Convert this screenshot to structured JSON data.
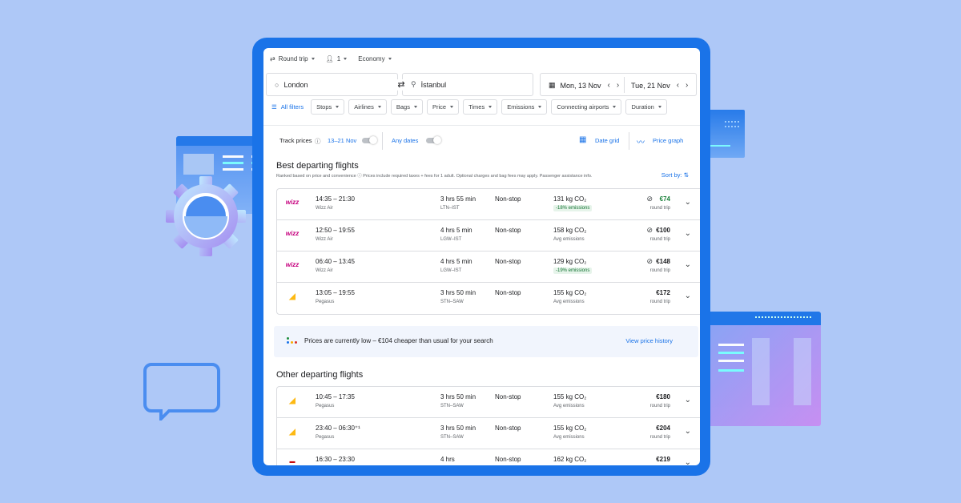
{
  "search": {
    "trip_type": "Round trip",
    "passengers": "1",
    "cabin": "Economy",
    "origin": "London",
    "destination": "İstanbul",
    "depart_date": "Mon, 13 Nov",
    "return_date": "Tue, 21 Nov"
  },
  "filters": {
    "all": "All filters",
    "chips": [
      "Stops",
      "Airlines",
      "Bags",
      "Price",
      "Times",
      "Emissions",
      "Connecting airports",
      "Duration"
    ]
  },
  "track": {
    "label": "Track prices",
    "range": "13–21 Nov",
    "any_dates": "Any dates",
    "date_grid": "Date grid",
    "price_graph": "Price graph"
  },
  "best": {
    "title": "Best departing flights",
    "note": "Ranked based on price and convenience ⓘ  Prices include required taxes + fees for 1 adult. Optional charges and bag fees may apply. Passenger assistance info.",
    "sort": "Sort by:",
    "flights": [
      {
        "times": "14:35 – 21:30",
        "airline": "Wizz Air",
        "duration": "3 hrs 55 min",
        "route": "LTN–IST",
        "stops": "Non-stop",
        "co2": "131 kg CO₂",
        "emissions": "-18% emissions",
        "price": "€74",
        "fare": "round trip"
      },
      {
        "times": "12:50 – 19:55",
        "airline": "Wizz Air",
        "duration": "4 hrs 5 min",
        "route": "LGW–IST",
        "stops": "Non-stop",
        "co2": "158 kg CO₂",
        "emissions": "Avg emissions",
        "price": "€100",
        "fare": "round trip"
      },
      {
        "times": "06:40 – 13:45",
        "airline": "Wizz Air",
        "duration": "4 hrs 5 min",
        "route": "LGW–IST",
        "stops": "Non-stop",
        "co2": "129 kg CO₂",
        "emissions": "-19% emissions",
        "price": "€148",
        "fare": "round trip"
      },
      {
        "times": "13:05 – 19:55",
        "airline": "Pegasus",
        "duration": "3 hrs 50 min",
        "route": "STN–SAW",
        "stops": "Non-stop",
        "co2": "155 kg CO₂",
        "emissions": "Avg emissions",
        "price": "€172",
        "fare": "round trip"
      }
    ]
  },
  "price_insight": {
    "text": "Prices are currently low – €104 cheaper than usual for your search",
    "link": "View price history"
  },
  "other": {
    "title": "Other departing flights",
    "flights": [
      {
        "times": "10:45 – 17:35",
        "airline": "Pegasus",
        "duration": "3 hrs 50 min",
        "route": "STN–SAW",
        "stops": "Non-stop",
        "co2": "155 kg CO₂",
        "emissions": "Avg emissions",
        "price": "€180",
        "fare": "round trip"
      },
      {
        "times": "23:40 – 06:30⁺¹",
        "airline": "Pegasus",
        "duration": "3 hrs 50 min",
        "route": "STN–SAW",
        "stops": "Non-stop",
        "co2": "155 kg CO₂",
        "emissions": "Avg emissions",
        "price": "€204",
        "fare": "round trip"
      },
      {
        "times": "16:30 – 23:30",
        "airline": "",
        "duration": "4 hrs",
        "route": "",
        "stops": "Non-stop",
        "co2": "162 kg CO₂",
        "emissions": "",
        "price": "€219",
        "fare": ""
      }
    ]
  },
  "colors": {
    "accent": "#1a73e8",
    "background": "#aec8f7",
    "low_price": "#188038"
  }
}
